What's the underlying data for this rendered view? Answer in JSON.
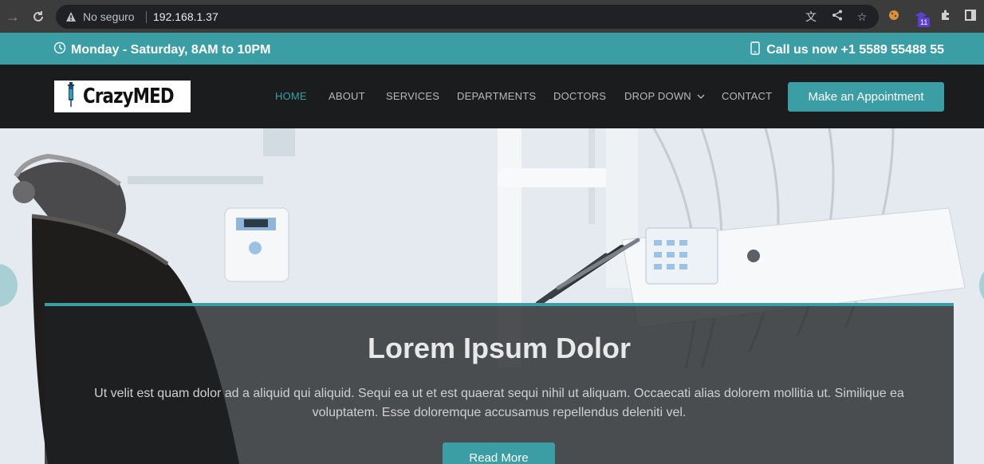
{
  "browser": {
    "security_label": "No seguro",
    "url": "192.168.1.37",
    "extension_badge": "11"
  },
  "topbar": {
    "hours": "Monday - Saturday, 8AM to 10PM",
    "phone": "Call us now +1 5589 55488 55"
  },
  "header": {
    "logo_text": "CrazyMED",
    "nav": [
      {
        "label": "HOME",
        "active": true
      },
      {
        "label": "ABOUT"
      },
      {
        "label": "SERVICES"
      },
      {
        "label": "DEPARTMENTS"
      },
      {
        "label": "DOCTORS"
      },
      {
        "label": "DROP DOWN"
      },
      {
        "label": "CONTACT"
      }
    ],
    "cta_label": "Make an Appointment"
  },
  "hero": {
    "title": "Lorem Ipsum Dolor",
    "text": "Ut velit est quam dolor ad a aliquid qui aliquid. Sequi ea ut et est quaerat sequi nihil ut aliquam. Occaecati alias dolorem mollitia ut. Similique ea voluptatem. Esse doloremque accusamus repellendus deleniti vel.",
    "button_label": "Read More"
  },
  "colors": {
    "accent": "#3a9ea4",
    "header_bg": "#1b1c1e"
  }
}
